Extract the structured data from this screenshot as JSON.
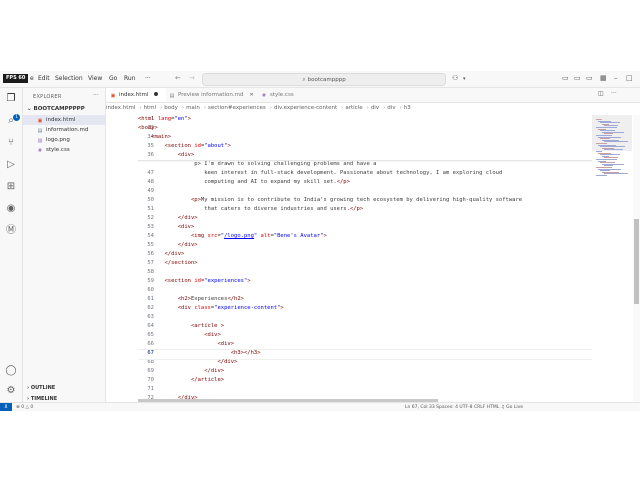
{
  "titlebar": {
    "fps": "FPS 60",
    "menus": [
      "e",
      "Edit",
      "Selection",
      "View",
      "Go",
      "Run",
      "···"
    ],
    "command_center": "bootcampppp",
    "back": "←",
    "forward": "→"
  },
  "activity": {
    "badge": "1"
  },
  "sidebar": {
    "title": "EXPLORER",
    "more": "···",
    "folder": "BOOTCAMPPPPP",
    "files": [
      {
        "name": "index.html",
        "icon": "html-file-icon",
        "color": "#e44d26"
      },
      {
        "name": "information.md",
        "icon": "markdown-file-icon",
        "color": "#6c7a89"
      },
      {
        "name": "logo.png",
        "icon": "image-file-icon",
        "color": "#a074c4"
      },
      {
        "name": "style.css",
        "icon": "css-file-icon",
        "color": "#7e57c2"
      }
    ],
    "outline": "OUTLINE",
    "timeline": "TIMELINE"
  },
  "tabs": [
    {
      "label": "index.html",
      "active": true,
      "icon": "html-file-icon"
    },
    {
      "label": "Preview information.md",
      "active": false,
      "icon": "preview-icon"
    },
    {
      "label": "style.css",
      "active": false,
      "icon": "css-file-icon"
    }
  ],
  "breadcrumb": [
    "index.html",
    "html",
    "body",
    "main",
    "section#experiences",
    "div.experience-content",
    "article",
    "div",
    "div",
    "h3"
  ],
  "editor": {
    "sticky": [
      {
        "ln": "1",
        "html": "<span class='tg'>&lt;html</span> <span class='at'>lang</span>=<span class='vl'>\"en\"</span><span class='tg'>&gt;</span>"
      },
      {
        "ln": "12",
        "html": "<span class='tg'>&lt;body&gt;</span>"
      },
      {
        "ln": "34",
        "html": "    <span class='tg'>&lt;main&gt;</span>"
      },
      {
        "ln": "35",
        "html": "        <span class='tg'>&lt;section</span> <span class='at'>id</span>=<span class='vl'>\"about\"</span><span class='tg'>&gt;</span>"
      },
      {
        "ln": "36",
        "html": "            <span class='tg'>&lt;div&gt;</span>"
      }
    ],
    "lines": [
      {
        "ln": "",
        "html": "                 <span class='tx'>p&gt; I'm drawn to solving challenging problems and have a</span>"
      },
      {
        "ln": "47",
        "html": "                    <span class='tx'>keen interest in full-stack development. Passionate about technology, I am exploring cloud</span>"
      },
      {
        "ln": "48",
        "html": "                    <span class='tx'>computing and AI to expand my skill set.</span><span class='tg'>&lt;/p&gt;</span>"
      },
      {
        "ln": "49",
        "html": ""
      },
      {
        "ln": "50",
        "html": "                <span class='tg'>&lt;p&gt;</span><span class='tx'>My mission is to contribute to India's growing tech ecosystem by delivering high-quality software</span>"
      },
      {
        "ln": "51",
        "html": "                    <span class='tx'>that caters to diverse industries and users.</span><span class='tg'>&lt;/p&gt;</span>"
      },
      {
        "ln": "52",
        "html": "            <span class='tg'>&lt;/div&gt;</span>"
      },
      {
        "ln": "53",
        "html": "            <span class='tg'>&lt;div&gt;</span>"
      },
      {
        "ln": "54",
        "html": "                <span class='tg'>&lt;img</span> <span class='at'>src</span>=<span class='vl'>\"<u>/logo.png</u>\"</span> <span class='at'>alt</span>=<span class='vl'>\"Bene's Avatar\"</span><span class='tg'>&gt;</span>"
      },
      {
        "ln": "55",
        "html": "            <span class='tg'>&lt;/div&gt;</span>"
      },
      {
        "ln": "56",
        "html": "        <span class='tg'>&lt;/div&gt;</span>"
      },
      {
        "ln": "57",
        "html": "        <span class='tg'>&lt;/section&gt;</span>"
      },
      {
        "ln": "58",
        "html": ""
      },
      {
        "ln": "59",
        "html": "        <span class='tg'>&lt;section</span> <span class='at'>id</span>=<span class='vl'>\"experiences\"</span><span class='tg'>&gt;</span>"
      },
      {
        "ln": "60",
        "html": ""
      },
      {
        "ln": "61",
        "html": "            <span class='tg'>&lt;h2&gt;</span><span class='tx'>Experiences</span><span class='tg'>&lt;/h2&gt;</span>"
      },
      {
        "ln": "62",
        "html": "            <span class='tg'>&lt;div</span> <span class='at'>class</span>=<span class='vl'>\"experience-content\"</span><span class='tg'>&gt;</span>"
      },
      {
        "ln": "63",
        "html": ""
      },
      {
        "ln": "64",
        "html": "                <span class='tg'>&lt;article</span> <span class='tg'>&gt;</span>"
      },
      {
        "ln": "65",
        "html": "                    <span class='tg'>&lt;div&gt;</span>"
      },
      {
        "ln": "66",
        "html": "                        <span class='tg'>&lt;div&gt;</span>"
      },
      {
        "ln": "67",
        "html": "                            <span class='tg'>&lt;h3&gt;&lt;/h3&gt;</span>"
      },
      {
        "ln": "68",
        "html": "                        <span class='tg'>&lt;/div&gt;</span>"
      },
      {
        "ln": "69",
        "html": "                    <span class='tg'>&lt;/div&gt;</span>"
      },
      {
        "ln": "70",
        "html": "                <span class='tg'>&lt;/article&gt;</span>"
      },
      {
        "ln": "71",
        "html": ""
      },
      {
        "ln": "72",
        "html": "            <span class='tg'>&lt;/div&gt;</span>"
      }
    ],
    "current_line": "67"
  },
  "statusbar": {
    "remote": "⊻",
    "errors": "⊗ 0 △ 0",
    "right": "Ln 67, Col 33   Spaces: 4   UTF-8   CRLF   HTML   ♫   Go Live"
  }
}
